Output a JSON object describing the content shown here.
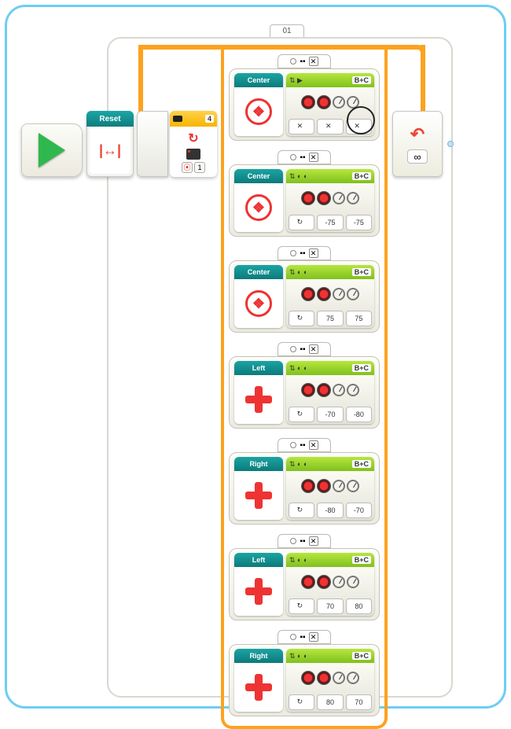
{
  "loop": {
    "tab": "01",
    "mode": "∞"
  },
  "start": {
    "reset_label": "Reset"
  },
  "ir_sensor": {
    "port": "4",
    "channel": "1"
  },
  "cases": [
    {
      "beacon_label": "Center",
      "beacon_type": "swirl",
      "motor_port": "B+C",
      "motor_mode": "stop",
      "p1_icon": "x",
      "p2_icon": "x",
      "p1": "",
      "p2": "",
      "header_icons": "⇅ ▶"
    },
    {
      "beacon_label": "Center",
      "beacon_type": "swirl",
      "motor_port": "B+C",
      "motor_mode": "on",
      "p1": "-75",
      "p2": "-75",
      "header_icons": "⇅ ◐ ◐"
    },
    {
      "beacon_label": "Center",
      "beacon_type": "swirl",
      "motor_port": "B+C",
      "motor_mode": "on",
      "p1": "75",
      "p2": "75",
      "header_icons": "⇅ ◐ ◐"
    },
    {
      "beacon_label": "Left",
      "beacon_type": "dpad",
      "motor_port": "B+C",
      "motor_mode": "on",
      "p1": "-70",
      "p2": "-80",
      "header_icons": "⇅ ◐ ◐"
    },
    {
      "beacon_label": "Right",
      "beacon_type": "dpad",
      "motor_port": "B+C",
      "motor_mode": "on",
      "p1": "-80",
      "p2": "-70",
      "header_icons": "⇅ ◐ ◐"
    },
    {
      "beacon_label": "Left",
      "beacon_type": "dpad",
      "motor_port": "B+C",
      "motor_mode": "on",
      "p1": "70",
      "p2": "80",
      "header_icons": "⇅ ◐ ◐"
    },
    {
      "beacon_label": "Right",
      "beacon_type": "dpad",
      "motor_port": "B+C",
      "motor_mode": "on",
      "p1": "80",
      "p2": "70",
      "header_icons": "⇅ ◐ ◐"
    }
  ],
  "tab_icons": {
    "radio": "○",
    "joy": "▪▪",
    "close": "✕"
  }
}
